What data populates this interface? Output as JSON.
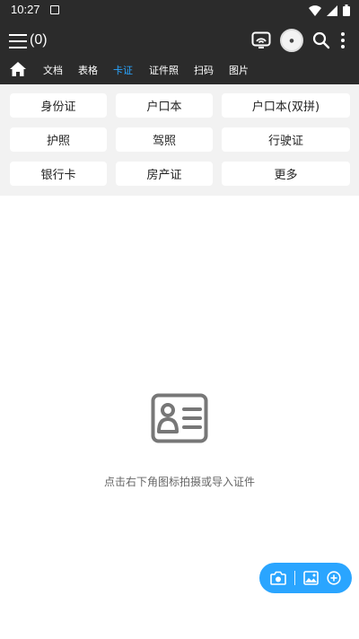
{
  "status_bar": {
    "time": "10:27"
  },
  "header": {
    "count": "(0)"
  },
  "tabs": [
    {
      "label": "文档"
    },
    {
      "label": "表格"
    },
    {
      "label": "卡证",
      "active": true
    },
    {
      "label": "证件照"
    },
    {
      "label": "扫码"
    },
    {
      "label": "图片"
    }
  ],
  "categories": [
    {
      "label": "身份证"
    },
    {
      "label": "户口本"
    },
    {
      "label": "户口本(双拼)"
    },
    {
      "label": "护照"
    },
    {
      "label": "驾照"
    },
    {
      "label": "行驶证"
    },
    {
      "label": "银行卡"
    },
    {
      "label": "房产证"
    },
    {
      "label": "更多"
    }
  ],
  "empty_state": {
    "message": "点击右下角图标拍摄或导入证件"
  },
  "colors": {
    "accent": "#2aa5ff",
    "toolbar_bg": "#2b2b2b",
    "grid_bg": "#f2f2f2"
  },
  "icons": [
    "menu-icon",
    "cast-icon",
    "avatar",
    "search-icon",
    "more-vertical-icon",
    "home-icon",
    "id-card-icon",
    "camera-icon",
    "image-icon",
    "add-circle-icon"
  ]
}
